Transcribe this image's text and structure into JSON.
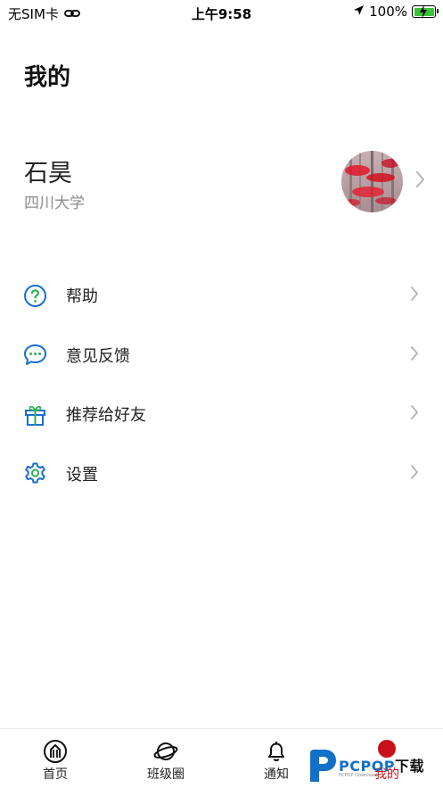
{
  "status_bar": {
    "carrier": "无SIM卡",
    "time": "上午9:58",
    "battery_percent": "100%"
  },
  "page": {
    "title": "我的"
  },
  "profile": {
    "name": "石昊",
    "school": "四川大学"
  },
  "menu": {
    "items": [
      {
        "label": "帮助",
        "icon": "help-icon"
      },
      {
        "label": "意见反馈",
        "icon": "feedback-icon"
      },
      {
        "label": "推荐给好友",
        "icon": "gift-icon"
      },
      {
        "label": "设置",
        "icon": "settings-icon"
      }
    ]
  },
  "tab_bar": {
    "tabs": [
      {
        "label": "首页",
        "icon": "home-icon"
      },
      {
        "label": "班级圈",
        "icon": "planet-icon"
      },
      {
        "label": "通知",
        "icon": "bell-icon"
      },
      {
        "label": "我的",
        "icon": "profile-icon",
        "active": true
      }
    ]
  },
  "watermark": {
    "brand": "PCPOP",
    "suffix": "下载",
    "sub": "PCPOP Download"
  },
  "colors": {
    "accent_blue": "#1a6fd4",
    "accent_green": "#2fb15a",
    "active_red": "#d0101a",
    "secondary_text": "#8c8c8c"
  }
}
